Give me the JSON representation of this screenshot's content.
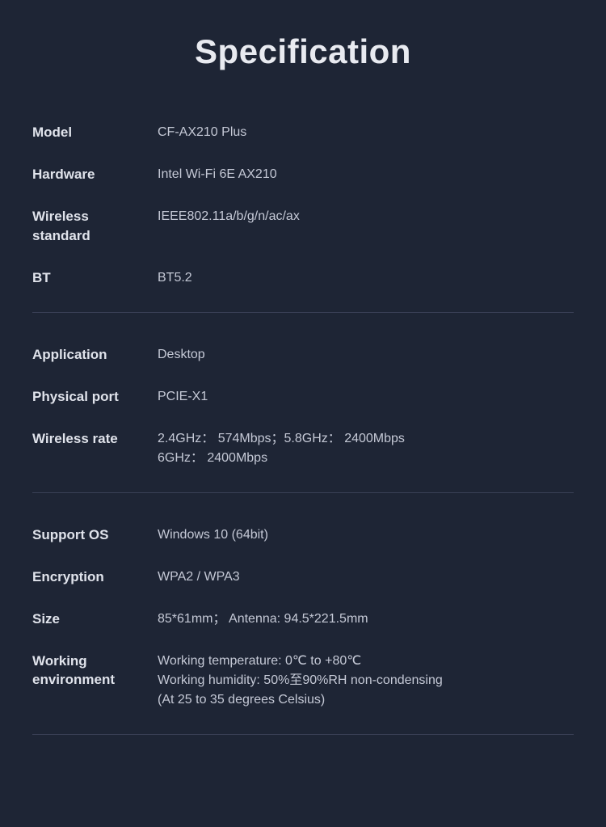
{
  "page": {
    "title": "Specification",
    "background_color": "#1e2535"
  },
  "sections": [
    {
      "id": "section-hardware",
      "rows": [
        {
          "label": "Model",
          "value": "CF-AX210 Plus"
        },
        {
          "label": "Hardware",
          "value": "Intel  Wi-Fi 6E AX210"
        },
        {
          "label": "Wireless standard",
          "value": "IEEE802.11a/b/g/n/ac/ax"
        },
        {
          "label": "BT",
          "value": "BT5.2"
        }
      ]
    },
    {
      "id": "section-application",
      "rows": [
        {
          "label": "Application",
          "value": "Desktop"
        },
        {
          "label": "Physical port",
          "value": "PCIE-X1"
        },
        {
          "label": "Wireless rate",
          "value": "2.4GHz： 574Mbps；5.8GHz：  2400Mbps\n6GHz：  2400Mbps"
        }
      ]
    },
    {
      "id": "section-os",
      "rows": [
        {
          "label": "Support OS",
          "value": "Windows 10 (64bit)"
        },
        {
          "label": "Encryption",
          "value": " WPA2 / WPA3"
        },
        {
          "label": "Size",
          "value": "85*61mm；  Antenna: 94.5*221.5mm"
        },
        {
          "label": "Working environment",
          "value": "Working temperature: 0℃ to +80℃\nWorking humidity: 50%至90%RH non-condensing\n(At 25 to 35 degrees Celsius)"
        }
      ]
    }
  ],
  "divider_color": "#3a4056"
}
